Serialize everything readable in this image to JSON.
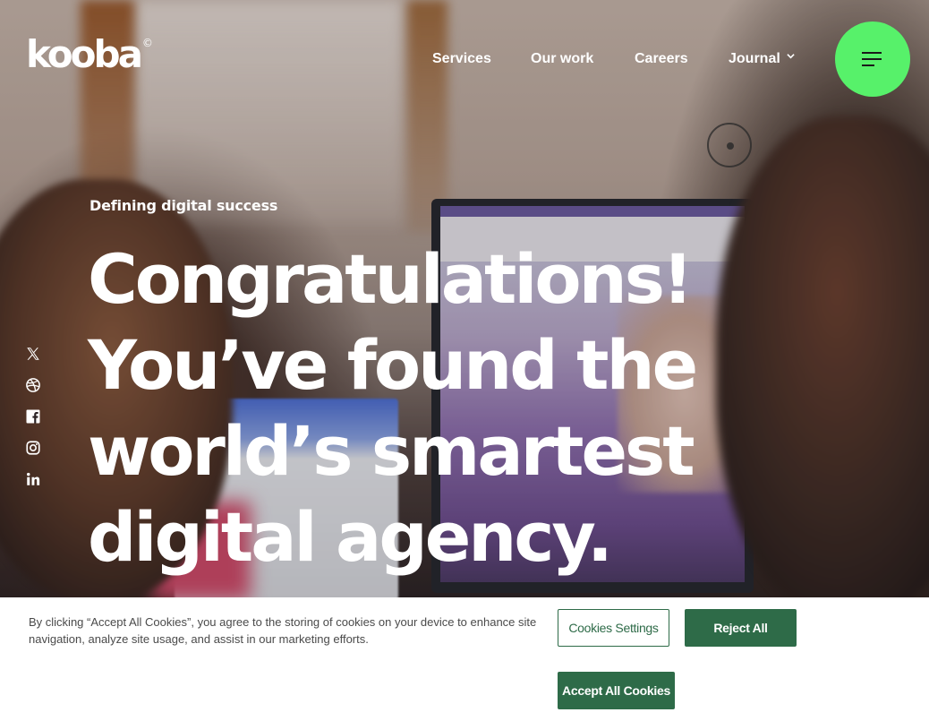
{
  "brand": {
    "logo_text": "kooba",
    "logo_mark": "©",
    "accent_color": "#57f16a",
    "cookie_green": "#2e6b48"
  },
  "nav": {
    "items": [
      {
        "label": "Services"
      },
      {
        "label": "Our work"
      },
      {
        "label": "Careers"
      },
      {
        "label": "Journal",
        "icon": "chevron-down-icon"
      }
    ],
    "menu_icon": "hamburger-icon"
  },
  "hero": {
    "eyebrow": "Defining digital success",
    "headline_lines": [
      "Congratulations!",
      "You’ve found the",
      "world’s smartest",
      "digital agency."
    ],
    "scroll_indicator_icon": "scroll-dot-icon"
  },
  "social": [
    {
      "name": "x-icon"
    },
    {
      "name": "dribbble-icon"
    },
    {
      "name": "facebook-icon"
    },
    {
      "name": "instagram-icon"
    },
    {
      "name": "linkedin-icon"
    }
  ],
  "cookie_banner": {
    "text": "By clicking “Accept All Cookies”, you agree to the storing of cookies on your device to enhance site navigation, analyze site usage, and assist in our marketing efforts.",
    "settings_label": "Cookies Settings",
    "reject_label": "Reject All",
    "accept_label": "Accept All Cookies"
  }
}
